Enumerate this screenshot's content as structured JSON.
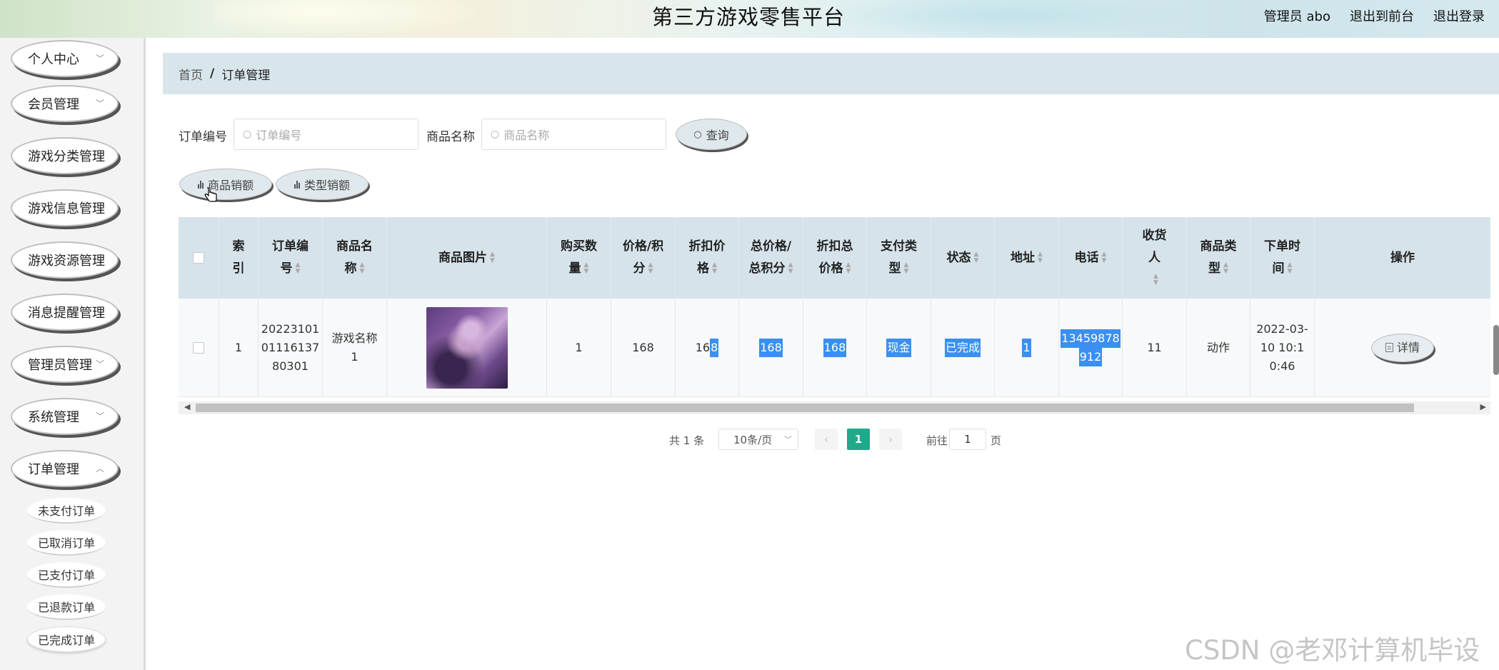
{
  "header": {
    "site_title": "第三方游戏零售平台",
    "admin_label": "管理员 abo",
    "back_to_front": "退出到前台",
    "logout": "退出登录"
  },
  "sidebar": {
    "items": [
      {
        "label": "个人中心"
      },
      {
        "label": "会员管理"
      },
      {
        "label": "游戏分类管理"
      },
      {
        "label": "游戏信息管理"
      },
      {
        "label": "游戏资源管理"
      },
      {
        "label": "消息提醒管理"
      },
      {
        "label": "管理员管理"
      },
      {
        "label": "系统管理"
      },
      {
        "label": "订单管理"
      }
    ],
    "sub_items": [
      {
        "label": "未支付订单"
      },
      {
        "label": "已取消订单"
      },
      {
        "label": "已支付订单"
      },
      {
        "label": "已退款订单"
      },
      {
        "label": "已完成订单",
        "active": true
      }
    ]
  },
  "breadcrumb": {
    "home": "首页",
    "separator": "/",
    "current": "订单管理"
  },
  "search": {
    "order_no_label": "订单编号",
    "order_no_placeholder": "订单编号",
    "product_name_label": "商品名称",
    "product_name_placeholder": "商品名称",
    "query_button": "查询"
  },
  "chart_buttons": {
    "product_sales": "商品销额",
    "type_sales": "类型销额"
  },
  "table": {
    "headers": {
      "index": "索引",
      "order_no": "订单编号",
      "product_name": "商品名称",
      "product_image": "商品图片",
      "quantity": "购买数量",
      "price": "价格/积分",
      "discount_price": "折扣价格",
      "total": "总价格/总积分",
      "discount_total": "折扣总价格",
      "pay_type": "支付类型",
      "status": "状态",
      "address": "地址",
      "phone": "电话",
      "receiver": "收货人",
      "product_type": "商品类型",
      "order_time": "下单时间",
      "actions": "操作"
    },
    "rows": [
      {
        "index": "1",
        "order_no": "2022310101116137 80301",
        "order_no_display": "20223101\n01116137\n80301",
        "product_name": "游戏名称1",
        "product_name_display": "游戏名称\n1",
        "quantity": "1",
        "price": "168",
        "discount_price_a": "16",
        "discount_price_b": "8",
        "total": "168",
        "discount_total": "168",
        "pay_type": "现金",
        "status": "已完成",
        "address": "1",
        "phone_line1": "13459878",
        "phone_line2": "912",
        "receiver": "11",
        "product_type": "动作",
        "order_time_display": "2022-03-\n10 10:1\n0:46",
        "detail_button": "详情"
      }
    ]
  },
  "pagination": {
    "total_text": "共 1 条",
    "page_size": "10条/页",
    "current_page": "1",
    "goto_label": "前往",
    "goto_value": "1",
    "page_unit": "页"
  },
  "watermark": "CSDN @老邓计算机毕设",
  "colors": {
    "accent": "#20a98b",
    "header_bg": "#d6e3ea",
    "selection": "#3b8ff0"
  }
}
